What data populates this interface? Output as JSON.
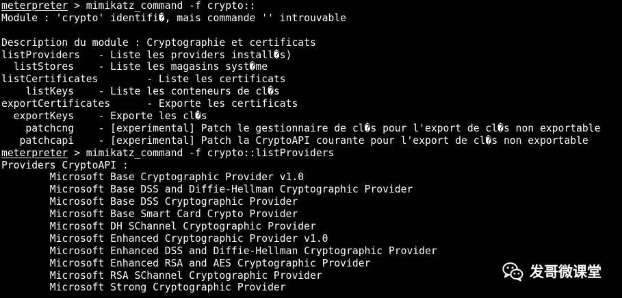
{
  "terminal": {
    "prompt": "meterpreter",
    "cmd1": " > mimikatz_command -f crypto::",
    "module_error": "Module : 'crypto' identifi�, mais commande '' introuvable",
    "blank": " ",
    "module_desc": "Description du module : Cryptographie et certificats",
    "command_lines": [
      "listProviders   - Liste les providers install�s)",
      "  listStores    - Liste les magasins syst�me",
      "listCertificates        - Liste les certificats",
      "    listKeys    - Liste les conteneurs de cl�s",
      "exportCertificates      - Exporte les certificats",
      "  exportKeys    - Exporte les cl�s",
      "    patchcng    - [experimental] Patch le gestionnaire de cl�s pour l'export de cl�s non exportable",
      "   patchcapi    - [experimental] Patch la CryptoAPI courante pour l'export de cl�s non exportable"
    ],
    "cmd2": " > mimikatz_command -f crypto::listProviders",
    "providers_header": "Providers CryptoAPI :",
    "providers": [
      "        Microsoft Base Cryptographic Provider v1.0",
      "        Microsoft Base DSS and Diffie-Hellman Cryptographic Provider",
      "        Microsoft Base DSS Cryptographic Provider",
      "        Microsoft Base Smart Card Crypto Provider",
      "        Microsoft DH SChannel Cryptographic Provider",
      "        Microsoft Enhanced Cryptographic Provider v1.0",
      "        Microsoft Enhanced DSS and Diffie-Hellman Cryptographic Provider",
      "        Microsoft Enhanced RSA and AES Cryptographic Provider",
      "        Microsoft RSA SChannel Cryptographic Provider",
      "        Microsoft Strong Cryptographic Provider"
    ]
  },
  "watermark": {
    "label": "发哥微课堂",
    "icon": "wechat-icon"
  },
  "colors": {
    "background": "#000000",
    "text": "#ffffff"
  }
}
